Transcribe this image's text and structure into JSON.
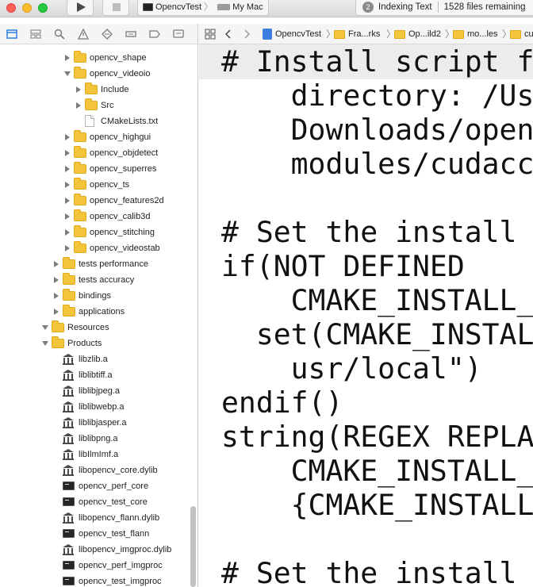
{
  "window": {
    "scheme_target": "OpencvTest",
    "destination": "My Mac",
    "activity": {
      "badge": "2",
      "status": "Indexing Text",
      "detail": "1528 files remaining"
    }
  },
  "navigator": {
    "tree": [
      {
        "label": "opencv_shape",
        "kind": "folder",
        "indent": 2,
        "disclosure": "closed"
      },
      {
        "label": "opencv_videoio",
        "kind": "folder",
        "indent": 2,
        "disclosure": "open"
      },
      {
        "label": "Include",
        "kind": "folder",
        "indent": 3,
        "disclosure": "closed"
      },
      {
        "label": "Src",
        "kind": "folder",
        "indent": 3,
        "disclosure": "closed"
      },
      {
        "label": "CMakeLists.txt",
        "kind": "file",
        "indent": 3,
        "disclosure": "none"
      },
      {
        "label": "opencv_highgui",
        "kind": "folder",
        "indent": 2,
        "disclosure": "closed"
      },
      {
        "label": "opencv_objdetect",
        "kind": "folder",
        "indent": 2,
        "disclosure": "closed"
      },
      {
        "label": "opencv_superres",
        "kind": "folder",
        "indent": 2,
        "disclosure": "closed"
      },
      {
        "label": "opencv_ts",
        "kind": "folder",
        "indent": 2,
        "disclosure": "closed"
      },
      {
        "label": "opencv_features2d",
        "kind": "folder",
        "indent": 2,
        "disclosure": "closed"
      },
      {
        "label": "opencv_calib3d",
        "kind": "folder",
        "indent": 2,
        "disclosure": "closed"
      },
      {
        "label": "opencv_stitching",
        "kind": "folder",
        "indent": 2,
        "disclosure": "closed"
      },
      {
        "label": "opencv_videostab",
        "kind": "folder",
        "indent": 2,
        "disclosure": "closed"
      },
      {
        "label": "tests performance",
        "kind": "folder",
        "indent": 1,
        "disclosure": "closed"
      },
      {
        "label": "tests accuracy",
        "kind": "folder",
        "indent": 1,
        "disclosure": "closed"
      },
      {
        "label": "bindings",
        "kind": "folder",
        "indent": 1,
        "disclosure": "closed"
      },
      {
        "label": "applications",
        "kind": "folder",
        "indent": 1,
        "disclosure": "closed"
      },
      {
        "label": "Resources",
        "kind": "folder",
        "indent": 0,
        "disclosure": "open"
      },
      {
        "label": "Products",
        "kind": "folder",
        "indent": 0,
        "disclosure": "open"
      },
      {
        "label": "libzlib.a",
        "kind": "library",
        "indent": 1,
        "disclosure": "none"
      },
      {
        "label": "liblibtiff.a",
        "kind": "library",
        "indent": 1,
        "disclosure": "none"
      },
      {
        "label": "liblibjpeg.a",
        "kind": "library",
        "indent": 1,
        "disclosure": "none"
      },
      {
        "label": "liblibwebp.a",
        "kind": "library",
        "indent": 1,
        "disclosure": "none"
      },
      {
        "label": "liblibjasper.a",
        "kind": "library",
        "indent": 1,
        "disclosure": "none"
      },
      {
        "label": "liblibpng.a",
        "kind": "library",
        "indent": 1,
        "disclosure": "none"
      },
      {
        "label": "libIlmImf.a",
        "kind": "library",
        "indent": 1,
        "disclosure": "none"
      },
      {
        "label": "libopencv_core.dylib",
        "kind": "library",
        "indent": 1,
        "disclosure": "none"
      },
      {
        "label": "opencv_perf_core",
        "kind": "executable",
        "indent": 1,
        "disclosure": "none"
      },
      {
        "label": "opencv_test_core",
        "kind": "executable",
        "indent": 1,
        "disclosure": "none"
      },
      {
        "label": "libopencv_flann.dylib",
        "kind": "library",
        "indent": 1,
        "disclosure": "none"
      },
      {
        "label": "opencv_test_flann",
        "kind": "executable",
        "indent": 1,
        "disclosure": "none"
      },
      {
        "label": "libopencv_imgproc.dylib",
        "kind": "library",
        "indent": 1,
        "disclosure": "none"
      },
      {
        "label": "opencv_perf_imgproc",
        "kind": "executable",
        "indent": 1,
        "disclosure": "none"
      },
      {
        "label": "opencv_test_imgproc",
        "kind": "executable",
        "indent": 1,
        "disclosure": "none"
      }
    ]
  },
  "jumpbar": {
    "items": [
      "OpencvTest",
      "Fra...rks",
      "Op...ild2",
      "mo...les",
      "cu"
    ]
  },
  "editor": {
    "lines": [
      "# Install script f",
      "    directory: /Us",
      "    Downloads/open",
      "    modules/cudacc",
      "",
      "# Set the install",
      "if(NOT DEFINED",
      "    CMAKE_INSTALL_",
      "  set(CMAKE_INSTAL",
      "    usr/local\")",
      "endif()",
      "string(REGEX REPLA",
      "    CMAKE_INSTALL_",
      "    {CMAKE_INSTALL",
      "",
      "# Set the install"
    ]
  },
  "colors": {
    "folder": "#f4c43a",
    "selection_icon": "#3c7ee0"
  },
  "icons": [
    "run-icon",
    "stop-icon",
    "project-navigator-icon",
    "source-control-icon",
    "symbol-icon",
    "find-icon",
    "issue-icon",
    "test-icon",
    "debug-icon",
    "breakpoint-icon",
    "report-icon",
    "related-items-icon",
    "back-icon",
    "forward-icon"
  ]
}
